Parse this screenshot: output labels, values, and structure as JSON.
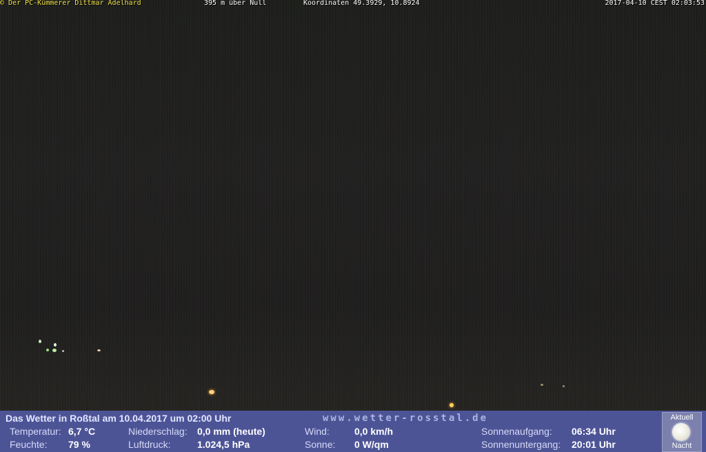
{
  "overlay_top": {
    "left": "© Der PC-Kümmerer Dittmar Adelhard",
    "altitude": "395 m über Null",
    "coordinates": "Koordinaten 49.3929, 10.8924",
    "datetime": "2017-04-10 CEST 02:03:53"
  },
  "info_bar": {
    "headline": "Das Wetter in Roßtal am 10.04.2017 um 02:00 Uhr",
    "website": "www.wetter-rosstal.de",
    "temperature_label": "Temperatur:",
    "temperature_value": "6,7 °C",
    "humidity_label": "Feuchte:",
    "humidity_value": "79 %",
    "precip_label": "Niederschlag:",
    "precip_value": "0,0 mm (heute)",
    "pressure_label": "Luftdruck:",
    "pressure_value": "1.024,5 hPa",
    "wind_label": "Wind:",
    "wind_value": "0,0 km/h",
    "sun_label": "Sonne:",
    "sun_value": "0 W/qm",
    "sunrise_label": "Sonnenaufgang:",
    "sunrise_value": "06:34 Uhr",
    "sunset_label": "Sonnenuntergang:",
    "sunset_value": "20:01 Uhr",
    "moon_top_label": "Aktuell",
    "moon_bottom_label": "Nacht",
    "moon_icon": "full-moon-icon"
  },
  "colors": {
    "overlay_title": "#f2e24a",
    "info_bar_bg": "#4d5496"
  }
}
